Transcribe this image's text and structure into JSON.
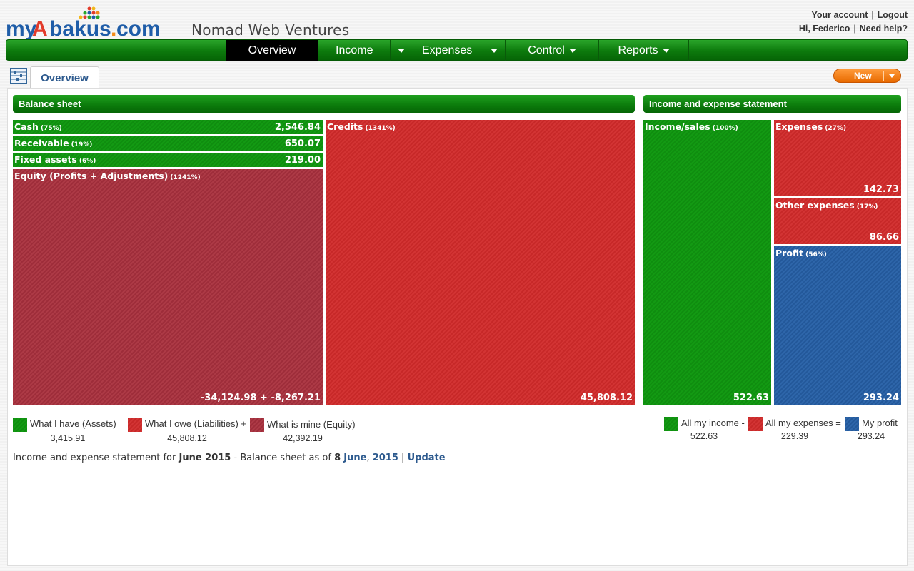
{
  "header": {
    "logo_text": "myAbakus.com",
    "company_name": "Nomad Web Ventures",
    "your_account": "Your account",
    "logout": "Logout",
    "greeting": "Hi, Federico",
    "need_help": "Need help?",
    "sep": "|"
  },
  "nav": {
    "items": [
      {
        "label": "Overview",
        "active": true,
        "has_menu": false
      },
      {
        "label": "Income",
        "active": false,
        "has_menu": true
      },
      {
        "label": "Expenses",
        "active": false,
        "has_menu": true
      },
      {
        "label": "Control",
        "active": false,
        "has_menu": true
      },
      {
        "label": "Reports",
        "active": false,
        "has_menu": true
      }
    ]
  },
  "tabs": {
    "active_tab": "Overview",
    "new_button": "New"
  },
  "balance_sheet": {
    "title": "Balance sheet",
    "tiles": [
      {
        "name": "Cash",
        "pct": "(75%)",
        "amount": "2,546.84",
        "color": "green"
      },
      {
        "name": "Receivable",
        "pct": "(19%)",
        "amount": "650.07",
        "color": "green"
      },
      {
        "name": "Fixed assets",
        "pct": "(6%)",
        "amount": "219.00",
        "color": "green"
      },
      {
        "name": "Equity (Profits + Adjustments)",
        "pct": "(1241%)",
        "amount": "-34,124.98 + -8,267.21",
        "color": "maroon"
      },
      {
        "name": "Credits",
        "pct": "(1341%)",
        "amount": "45,808.12",
        "color": "red"
      }
    ],
    "legend": [
      {
        "label": "What I have (Assets) =",
        "value": "3,415.91",
        "color": "#129412"
      },
      {
        "label": "What I owe (Liabilities) +",
        "value": "45,808.12",
        "color": "#cc2e2e"
      },
      {
        "label": "What is mine (Equity)",
        "value": "42,392.19",
        "color": "#a4333f"
      }
    ]
  },
  "income_statement": {
    "title": "Income and expense statement",
    "tiles": [
      {
        "name": "Income/sales",
        "pct": "(100%)",
        "amount": "522.63",
        "color": "green"
      },
      {
        "name": "Expenses",
        "pct": "(27%)",
        "amount": "142.73",
        "color": "red"
      },
      {
        "name": "Other expenses",
        "pct": "(17%)",
        "amount": "86.66",
        "color": "red"
      },
      {
        "name": "Profit",
        "pct": "(56%)",
        "amount": "293.24",
        "color": "blue"
      }
    ],
    "legend": [
      {
        "label": "All my income -",
        "value": "522.63",
        "color": "#129412"
      },
      {
        "label": "All my expenses =",
        "value": "229.39",
        "color": "#cc2e2e"
      },
      {
        "label": "My profit",
        "value": "293.24",
        "color": "#2860a2"
      }
    ]
  },
  "footer": {
    "prefix": "Income and expense statement for ",
    "period": "June 2015",
    "mid": " - Balance sheet as of ",
    "day": "8",
    "month": "June",
    "comma": ",",
    "year": "2015",
    "sep": "|",
    "update": "Update"
  },
  "colors": {
    "nav_green": "#0d7a0d",
    "link_blue": "#2d5a8e",
    "new_orange": "#f07a10"
  }
}
